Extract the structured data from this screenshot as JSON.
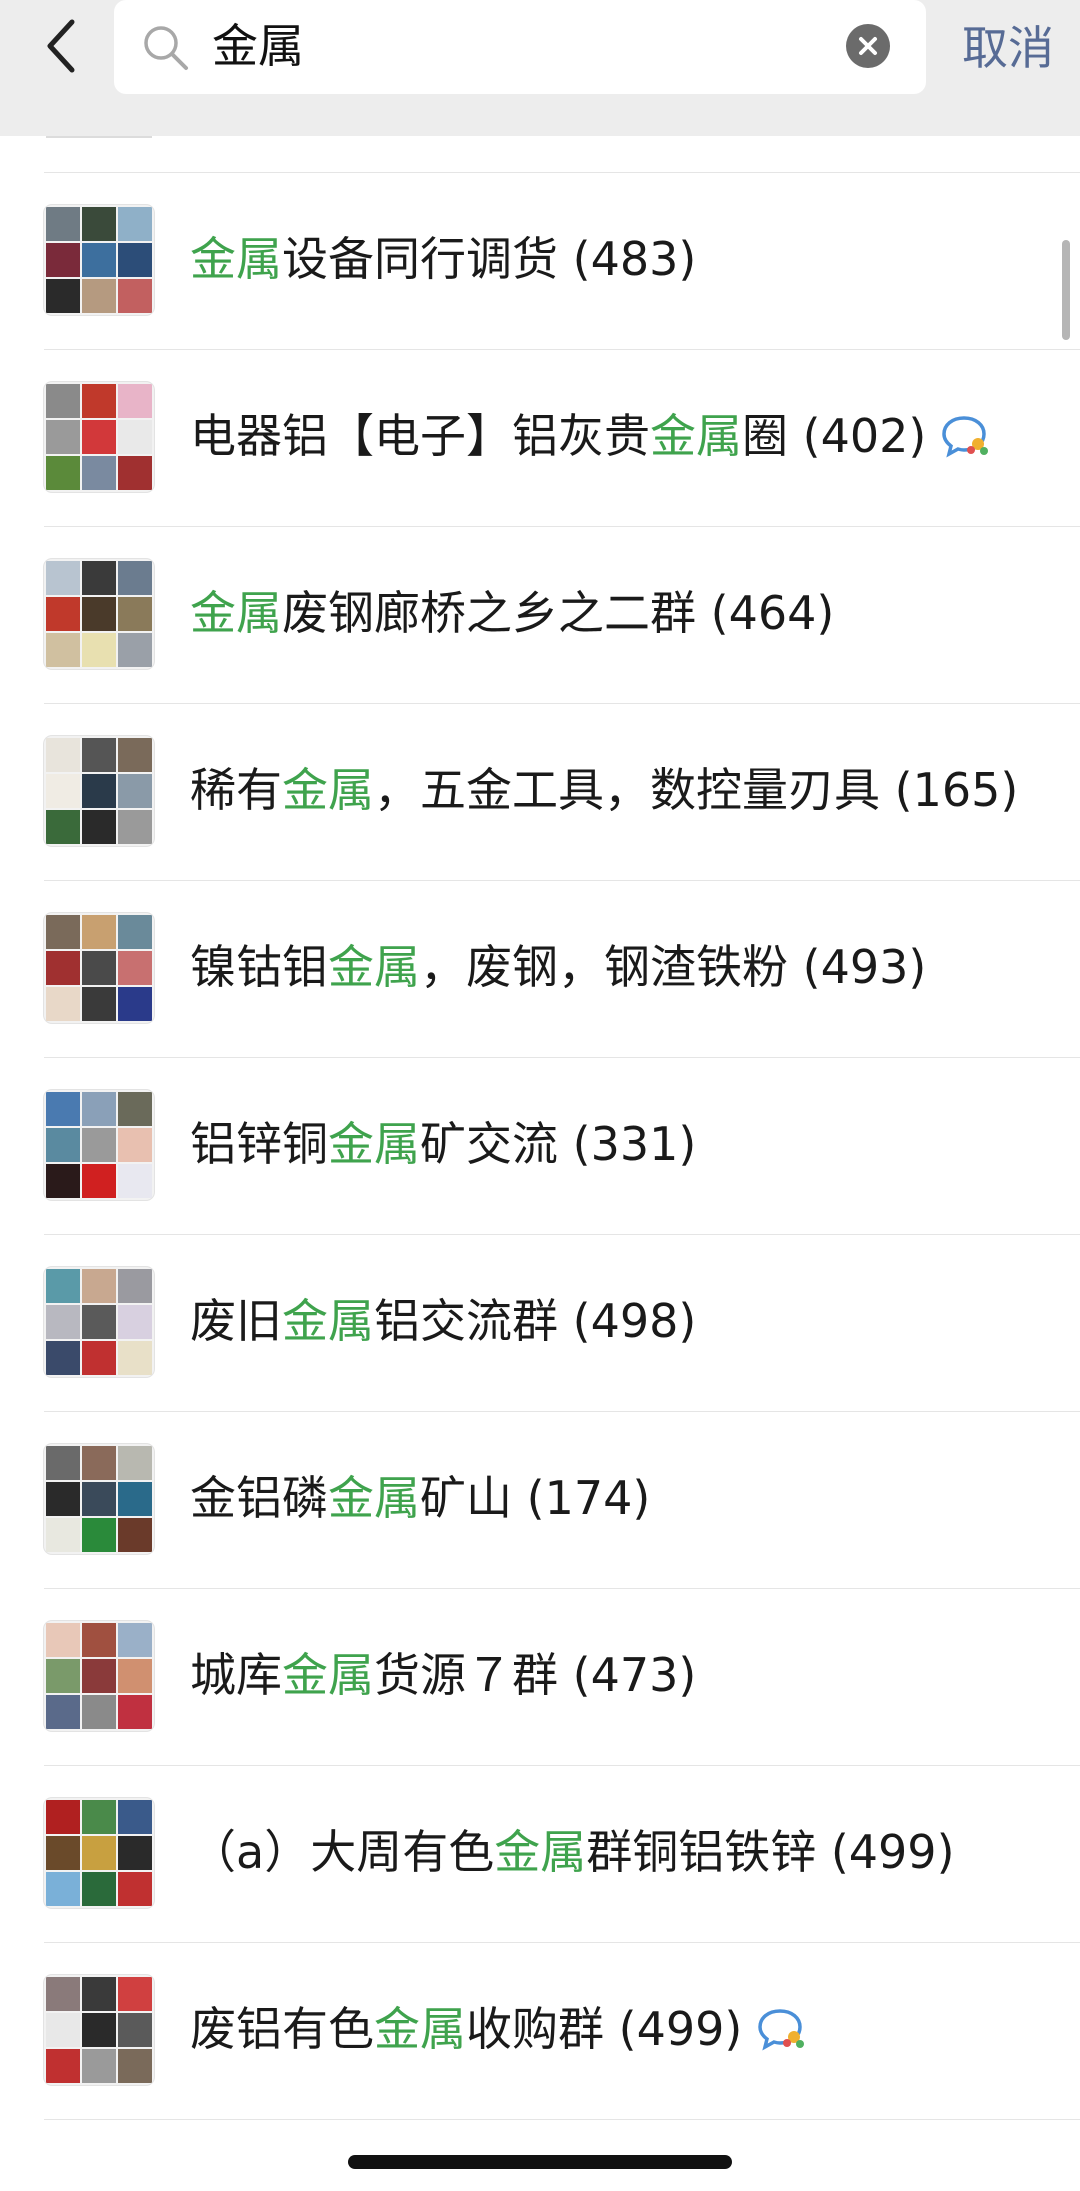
{
  "header": {
    "search_query": "金属",
    "cancel_label": "取消"
  },
  "results": [
    {
      "pre": "",
      "hl": "金属",
      "post": "设备同行调货",
      "count": "(483)",
      "badge": false,
      "colors": [
        "#6f7b84",
        "#3a4a3a",
        "#8fb0c8",
        "#7a2a3a",
        "#3d6f9e",
        "#2c4d78",
        "#2a2a2a",
        "#b59a80",
        "#c26060"
      ]
    },
    {
      "pre": "电器铝【电子】铝灰贵",
      "hl": "金属",
      "post": "圈",
      "count": "(402)",
      "badge": true,
      "colors": [
        "#8a8a8a",
        "#c0392b",
        "#e8b4c8",
        "#9a9a9a",
        "#d2383a",
        "#e9e9e9",
        "#5b8a3a",
        "#7a8aa0",
        "#a03030"
      ]
    },
    {
      "pre": "",
      "hl": "金属",
      "post": "废钢廊桥之乡之二群",
      "count": "(464)",
      "badge": false,
      "colors": [
        "#b8c4d0",
        "#3a3a3a",
        "#6b7c8f",
        "#c0392b",
        "#4a3a2a",
        "#8a7a5a",
        "#d0c0a0",
        "#e8e0b0",
        "#9aa0a8"
      ]
    },
    {
      "pre": "稀有",
      "hl": "金属",
      "post": "，五金工具，数控量刃具",
      "count": "(165)",
      "badge": false,
      "colors": [
        "#e8e4dc",
        "#555555",
        "#7a6a5a",
        "#f0ece4",
        "#2a3a4a",
        "#8a9aa8",
        "#3a6a3a",
        "#2a2a2a",
        "#9a9a9a"
      ]
    },
    {
      "pre": "镍钴钼",
      "hl": "金属",
      "post": "，废钢，钢渣铁粉",
      "count": "(493)",
      "badge": false,
      "colors": [
        "#7a6a5a",
        "#c8a070",
        "#6a8a9a",
        "#a03030",
        "#4a4a4a",
        "#c87070",
        "#e8d8c8",
        "#3a3a3a",
        "#2a3a8a"
      ]
    },
    {
      "pre": "铝锌铜",
      "hl": "金属",
      "post": "矿交流",
      "count": "(331)",
      "badge": false,
      "colors": [
        "#4a7ab0",
        "#8aa0b8",
        "#6a6a5a",
        "#5a8aa0",
        "#9a9a9a",
        "#e8c0b0",
        "#2a1a1a",
        "#d02020",
        "#e8e8f0"
      ]
    },
    {
      "pre": "废旧",
      "hl": "金属",
      "post": "铝交流群",
      "count": "(498)",
      "badge": false,
      "colors": [
        "#5a9aa8",
        "#c8a890",
        "#9a9aa0",
        "#b8b8c0",
        "#5a5a5a",
        "#d8d0e0",
        "#3a4a6a",
        "#c03030",
        "#e8e0c8"
      ]
    },
    {
      "pre": "金铝磷",
      "hl": "金属",
      "post": "矿山",
      "count": "(174)",
      "badge": false,
      "colors": [
        "#6a6a6a",
        "#8a6a5a",
        "#b8b8b0",
        "#2a2a2a",
        "#3a4a5a",
        "#2a6a8a",
        "#e8e8e0",
        "#2a8a3a",
        "#6a3a2a"
      ]
    },
    {
      "pre": "城库",
      "hl": "金属",
      "post": "货源７群",
      "count": "(473)",
      "badge": false,
      "colors": [
        "#e8c8b8",
        "#a05040",
        "#9ab0c8",
        "#7a9a6a",
        "#8a3a3a",
        "#d09070",
        "#5a6a8a",
        "#8a8a8a",
        "#c03040"
      ]
    },
    {
      "pre": "（a）大周有色",
      "hl": "金属",
      "post": "群铜铝铁锌",
      "count": "(499)",
      "badge": false,
      "colors": [
        "#b02020",
        "#4a8a4a",
        "#3a5a8a",
        "#6a4a2a",
        "#c8a040",
        "#2a2a2a",
        "#7ab0d8",
        "#2a6a3a",
        "#c03030"
      ]
    },
    {
      "pre": "废铝有色",
      "hl": "金属",
      "post": "收购群",
      "count": "(499)",
      "badge": true,
      "colors": [
        "#8a7a7a",
        "#3a3a3a",
        "#d04040",
        "#e8e8e8",
        "#2a2a2a",
        "#5a5a5a",
        "#c03030",
        "#9a9a9a",
        "#7a6a5a"
      ]
    }
  ]
}
